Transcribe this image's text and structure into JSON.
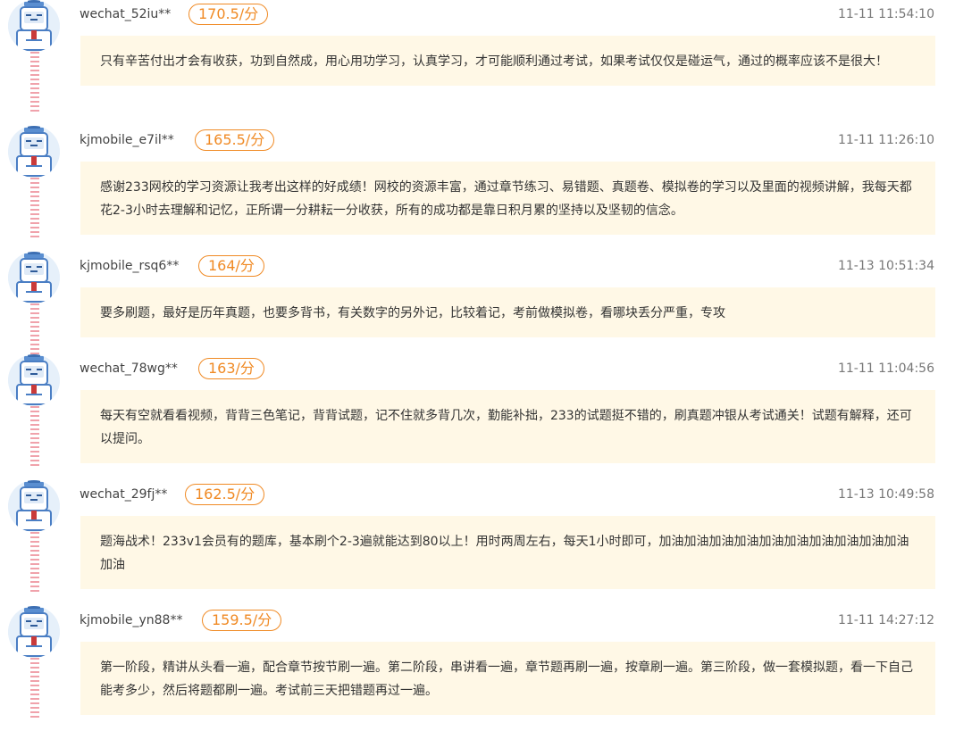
{
  "entries": [
    {
      "username": "wechat_52iu**",
      "score": "170.5/分",
      "timestamp": "11-11 11:54:10",
      "content": "只有辛苦付出才会有收获，功到自然成，用心用功学习，认真学习，才可能顺利通过考试，如果考试仅仅是碰运气，通过的概率应该不是很大！"
    },
    {
      "username": "kjmobile_e7il**",
      "score": "165.5/分",
      "timestamp": "11-11 11:26:10",
      "content": "感谢233网校的学习资源让我考出这样的好成绩！网校的资源丰富，通过章节练习、易错题、真题卷、模拟卷的学习以及里面的视频讲解，我每天都花2-3小时去理解和记忆，正所谓一分耕耘一分收获，所有的成功都是靠日积月累的坚持以及坚韧的信念。"
    },
    {
      "username": "kjmobile_rsq6**",
      "score": "164/分",
      "timestamp": "11-13 10:51:34",
      "content": "要多刷题，最好是历年真题，也要多背书，有关数字的另外记，比较着记，考前做模拟卷，看哪块丢分严重，专攻"
    },
    {
      "username": "wechat_78wg**",
      "score": "163/分",
      "timestamp": "11-11 11:04:56",
      "content": "每天有空就看看视频，背背三色笔记，背背试题，记不住就多背几次，勤能补拙，233的试题挺不错的，刷真题冲银从考试通关！试题有解释，还可以提问。"
    },
    {
      "username": "wechat_29fj**",
      "score": "162.5/分",
      "timestamp": "11-13 10:49:58",
      "content": "题海战术！233v1会员有的题库，基本刷个2-3遍就能达到80以上！用时两周左右，每天1小时即可，加油加油加油加油加油加油加油加油加油加油加油"
    },
    {
      "username": "kjmobile_yn88**",
      "score": "159.5/分",
      "timestamp": "11-11 14:27:12",
      "content": "第一阶段，精讲从头看一遍，配合章节按节刷一遍。第二阶段，串讲看一遍，章节题再刷一遍，按章刷一遍。第三阶段，做一套模拟题，看一下自己能考多少，然后将题都刷一遍。考试前三天把错题再过一遍。"
    }
  ]
}
